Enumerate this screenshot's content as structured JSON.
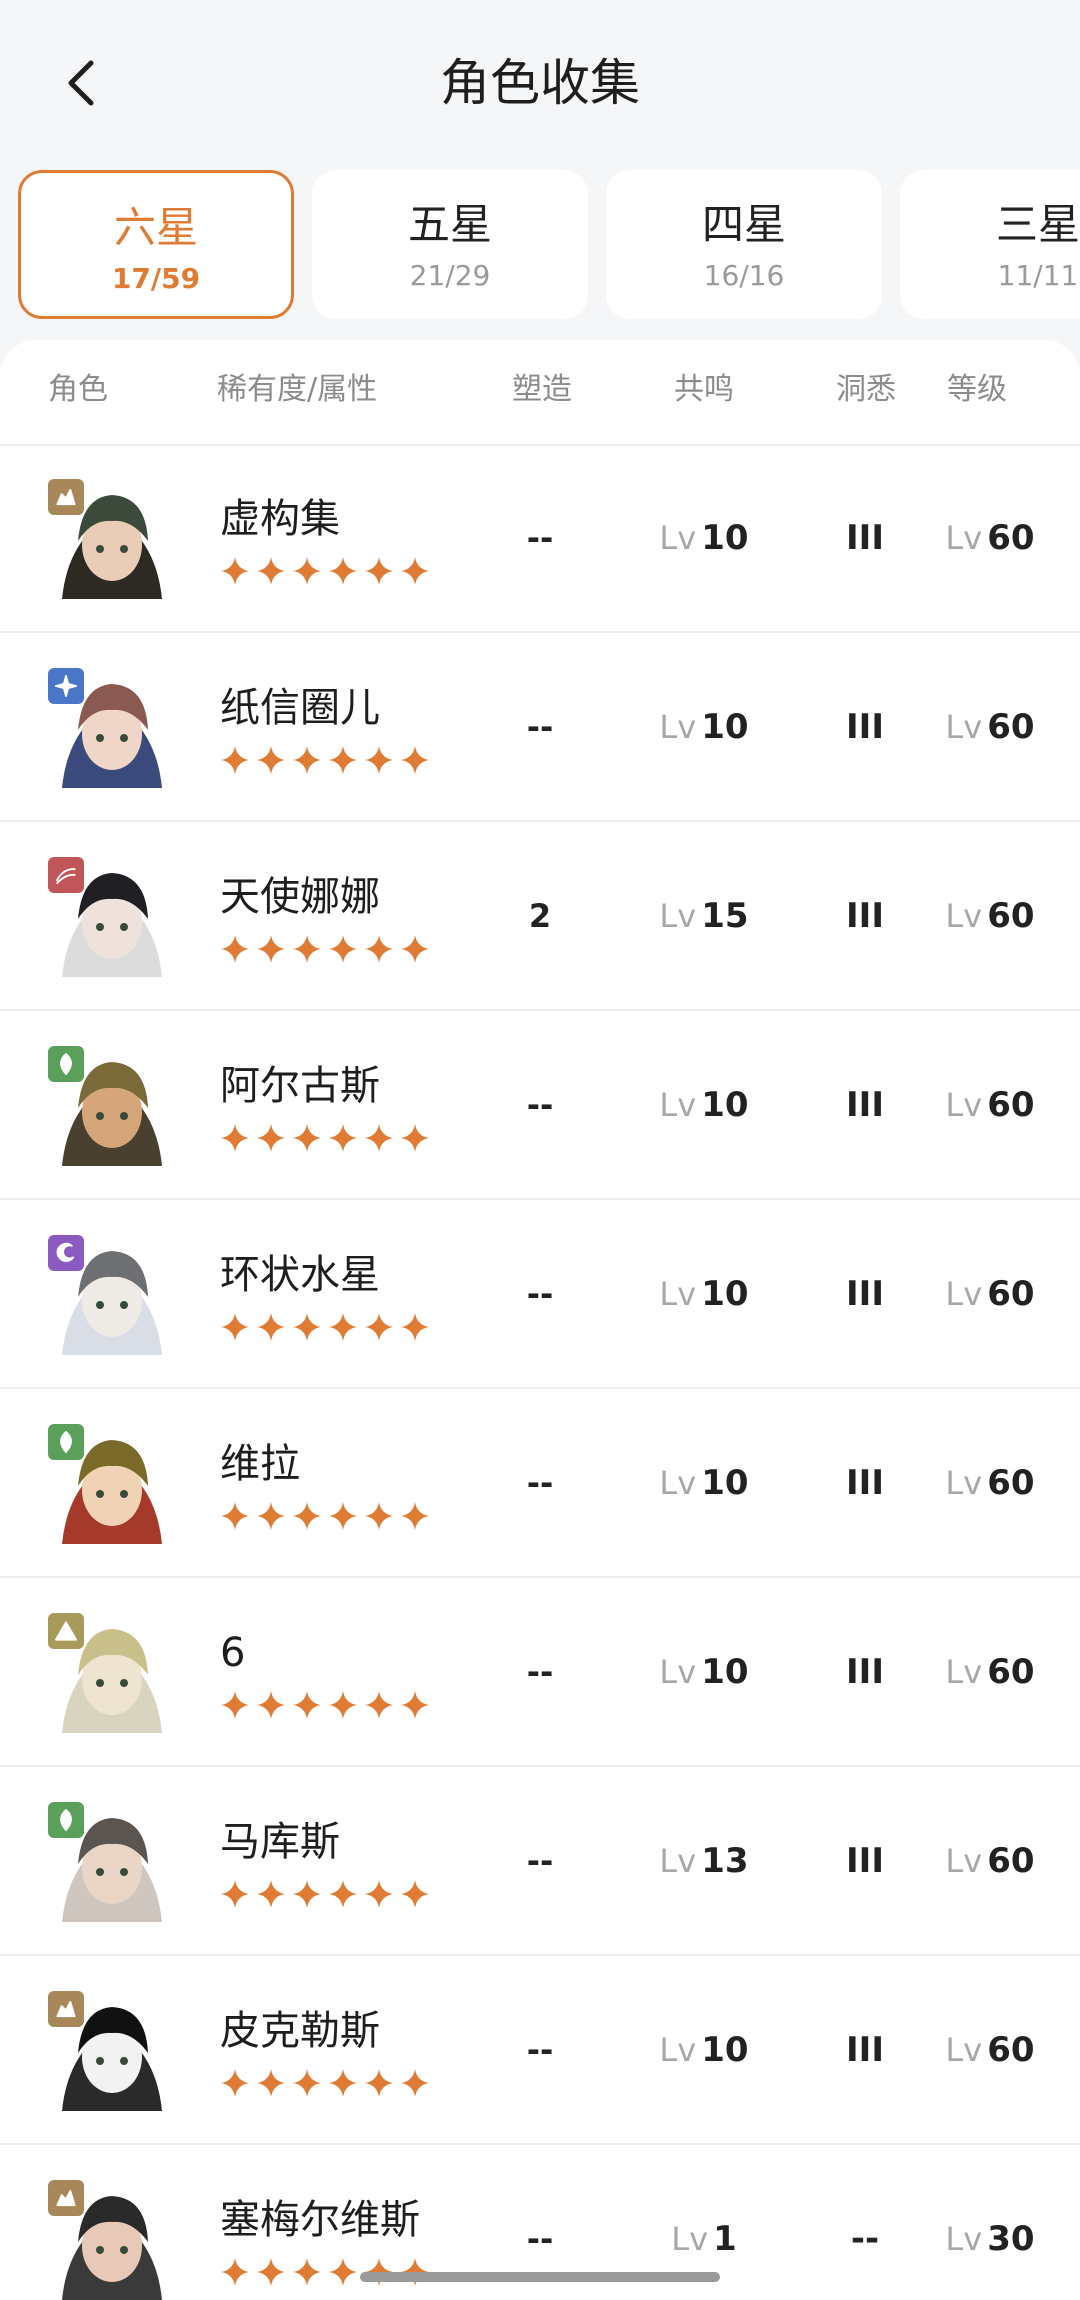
{
  "header": {
    "title": "角色收集",
    "back_icon": "chevron-left-icon"
  },
  "tabs": [
    {
      "name": "六星",
      "count": "17/59",
      "active": true
    },
    {
      "name": "五星",
      "count": "21/29",
      "active": false
    },
    {
      "name": "四星",
      "count": "16/16",
      "active": false
    },
    {
      "name": "三星",
      "count": "11/11",
      "active": false
    }
  ],
  "columns": {
    "character": "角色",
    "rarity_attr": "稀有度/属性",
    "shaping": "塑造",
    "resonance": "共鸣",
    "insight": "洞悉",
    "level": "等级"
  },
  "accent_color": "#e07b34",
  "star_count": 6,
  "characters": [
    {
      "name": "虚构集",
      "attr_icon": "beast-icon",
      "attr_color": "#a8885a",
      "shaping": "--",
      "res_prefix": "Lv",
      "res_value": "10",
      "insight": "III",
      "lvl_prefix": "Lv",
      "lvl_value": "60"
    },
    {
      "name": "纸信圈儿",
      "attr_icon": "star-sparkle-icon",
      "attr_color": "#4a76c8",
      "shaping": "--",
      "res_prefix": "Lv",
      "res_value": "10",
      "insight": "III",
      "lvl_prefix": "Lv",
      "lvl_value": "60"
    },
    {
      "name": "天使娜娜",
      "attr_icon": "wave-icon",
      "attr_color": "#c0565a",
      "shaping": "2",
      "res_prefix": "Lv",
      "res_value": "15",
      "insight": "III",
      "lvl_prefix": "Lv",
      "lvl_value": "60"
    },
    {
      "name": "阿尔古斯",
      "attr_icon": "leaf-icon",
      "attr_color": "#5aa05a",
      "shaping": "--",
      "res_prefix": "Lv",
      "res_value": "10",
      "insight": "III",
      "lvl_prefix": "Lv",
      "lvl_value": "60"
    },
    {
      "name": "环状水星",
      "attr_icon": "moon-icon",
      "attr_color": "#8a5ac0",
      "shaping": "--",
      "res_prefix": "Lv",
      "res_value": "10",
      "insight": "III",
      "lvl_prefix": "Lv",
      "lvl_value": "60"
    },
    {
      "name": "维拉",
      "attr_icon": "leaf-icon",
      "attr_color": "#5aa05a",
      "shaping": "--",
      "res_prefix": "Lv",
      "res_value": "10",
      "insight": "III",
      "lvl_prefix": "Lv",
      "lvl_value": "60"
    },
    {
      "name": "6",
      "attr_icon": "mineral-icon",
      "attr_color": "#a89a5a",
      "shaping": "--",
      "res_prefix": "Lv",
      "res_value": "10",
      "insight": "III",
      "lvl_prefix": "Lv",
      "lvl_value": "60"
    },
    {
      "name": "马库斯",
      "attr_icon": "leaf-icon",
      "attr_color": "#5aa05a",
      "shaping": "--",
      "res_prefix": "Lv",
      "res_value": "13",
      "insight": "III",
      "lvl_prefix": "Lv",
      "lvl_value": "60"
    },
    {
      "name": "皮克勒斯",
      "attr_icon": "beast-icon",
      "attr_color": "#a8885a",
      "shaping": "--",
      "res_prefix": "Lv",
      "res_value": "10",
      "insight": "III",
      "lvl_prefix": "Lv",
      "lvl_value": "60"
    },
    {
      "name": "塞梅尔维斯",
      "attr_icon": "beast-icon",
      "attr_color": "#a8885a",
      "shaping": "--",
      "res_prefix": "Lv",
      "res_value": "1",
      "insight": "--",
      "lvl_prefix": "Lv",
      "lvl_value": "30"
    }
  ]
}
